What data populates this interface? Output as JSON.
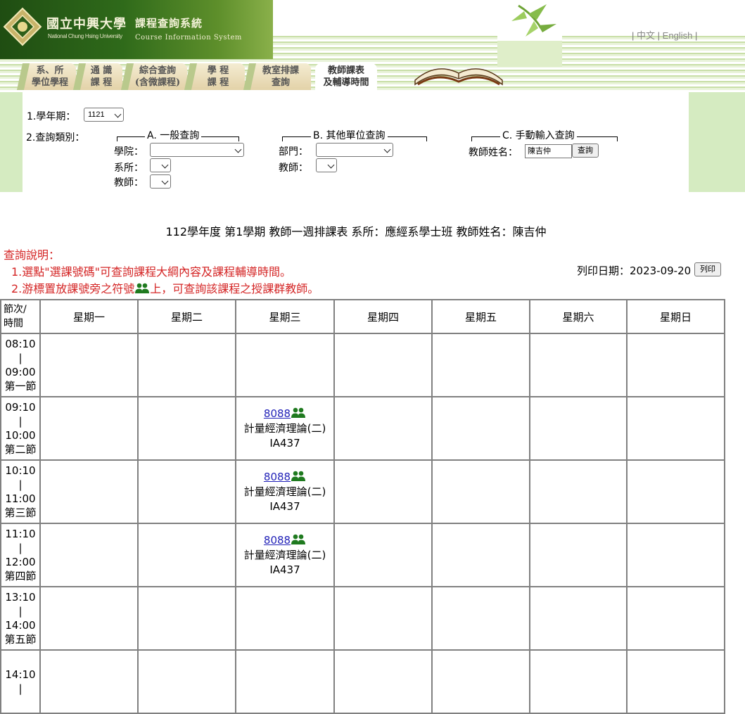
{
  "header": {
    "school_name_zh": "國立中興大學",
    "school_name_en": "National Chung Hsing University",
    "system_name_zh": "課程查詢系統",
    "system_name_en": "Course Information System",
    "lang_zh": "中文",
    "lang_en": "English",
    "lang_sep": "|"
  },
  "tabs": [
    {
      "line1": "系、所",
      "line2": "學位學程",
      "active": false
    },
    {
      "line1": "通 識",
      "line2": "課 程",
      "active": false
    },
    {
      "line1": "綜合查詢",
      "line2": "(含微課程)",
      "active": false
    },
    {
      "line1": "學 程",
      "line2": "課 程",
      "active": false
    },
    {
      "line1": "教室排課",
      "line2": "查詢",
      "active": false
    },
    {
      "line1": "教師課表",
      "line2": "及輔導時間",
      "active": true
    }
  ],
  "query": {
    "semester_label": "1.學年期：",
    "semester_value": "1121",
    "type_label": "2.查詢類別：",
    "group_a": {
      "title": "A. 一般查詢",
      "college_label": "學院：",
      "dept_label": "系所：",
      "teacher_label": "教師："
    },
    "group_b": {
      "title": "B. 其他單位查詢",
      "unit_label": "部門：",
      "teacher_label": "教師："
    },
    "group_c": {
      "title": "C. 手動輸入查詢",
      "name_label": "教師姓名：",
      "name_value": "陳吉仲",
      "search_button": "查詢"
    }
  },
  "schedule_title": "112學年度 第1學期 教師一週排課表 系所：應經系學士班 教師姓名：陳吉仲",
  "notes": {
    "heading": "查詢說明：",
    "line1": "1.選點\"選課號碼\"可查詢課程大綱內容及課程輔導時間。",
    "line2_before": "2.游標置放課號旁之符號",
    "line2_after": "上，可查詢該課程之授課群教師。"
  },
  "print": {
    "date_label": "列印日期：2023-09-20",
    "button": "列印"
  },
  "timetable": {
    "corner_line1": "節次/",
    "corner_line2": "時間",
    "days": [
      "星期一",
      "星期二",
      "星期三",
      "星期四",
      "星期五",
      "星期六",
      "星期日"
    ],
    "periods": [
      {
        "start": "08:10",
        "end": "09:00",
        "name": "第一節",
        "wed": null
      },
      {
        "start": "09:10",
        "end": "10:00",
        "name": "第二節",
        "wed": {
          "code": "8088",
          "course": "計量經濟理論(二)",
          "room": "IA437"
        }
      },
      {
        "start": "10:10",
        "end": "11:00",
        "name": "第三節",
        "wed": {
          "code": "8088",
          "course": "計量經濟理論(二)",
          "room": "IA437"
        }
      },
      {
        "start": "11:10",
        "end": "12:00",
        "name": "第四節",
        "wed": {
          "code": "8088",
          "course": "計量經濟理論(二)",
          "room": "IA437"
        }
      },
      {
        "start": "13:10",
        "end": "14:00",
        "name": "第五節",
        "wed": null
      },
      {
        "start": "14:10",
        "end": "",
        "name": "",
        "wed": null
      }
    ],
    "time_separator": "|"
  },
  "colors": {
    "note_red": "#d42424",
    "link_blue": "#2323b8",
    "icon_green": "#1f7a1f",
    "form_band": "#d5ebc1"
  }
}
